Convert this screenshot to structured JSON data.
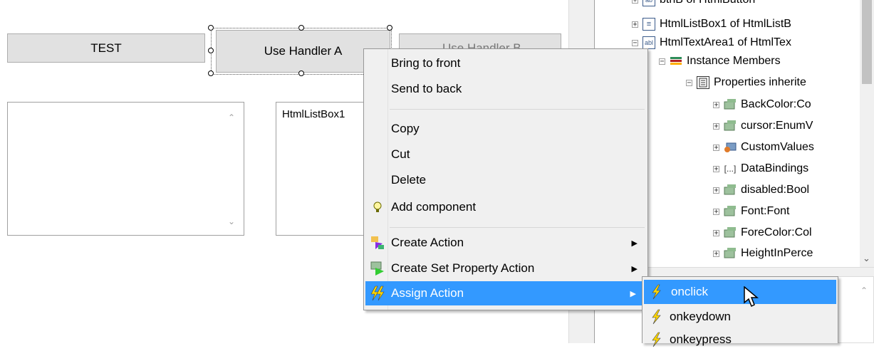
{
  "designer": {
    "test_button": "TEST",
    "handler_a_button": "Use Handler A",
    "handler_b_button": "Use Handler B",
    "listbox_label": "HtmlListBox1"
  },
  "context_menu": {
    "items": [
      {
        "label": "Bring to front"
      },
      {
        "label": "Send to back"
      },
      {
        "label": "Copy"
      },
      {
        "label": "Cut"
      },
      {
        "label": "Delete"
      },
      {
        "label": "Add component",
        "icon": "lightbulb-icon"
      },
      {
        "label": "Create Action",
        "icon": "create-action-icon",
        "submenu": true
      },
      {
        "label": "Create Set Property Action",
        "icon": "set-property-icon",
        "submenu": true
      },
      {
        "label": "Assign Action",
        "icon": "assign-action-icon",
        "submenu": true,
        "highlighted": true
      }
    ]
  },
  "submenu": {
    "items": [
      {
        "label": "onclick",
        "icon": "lightning-icon",
        "highlighted": true
      },
      {
        "label": "onkeydown",
        "icon": "lightning-icon"
      },
      {
        "label": "onkeypress",
        "icon": "lightning-icon"
      }
    ]
  },
  "tree": {
    "rows": [
      {
        "label": "btnB of HtmlButton",
        "icon": "ab-icon"
      },
      {
        "label": "HtmlListBox1 of HtmlListB",
        "icon": "listbox-icon"
      },
      {
        "label": "HtmlTextArea1 of HtmlTex",
        "icon": "textarea-icon"
      },
      {
        "label": "Instance Members",
        "icon": "members-icon"
      },
      {
        "label": "Properties inherite",
        "icon": "properties-icon"
      },
      {
        "label": "BackColor:Co",
        "icon": "property-icon"
      },
      {
        "label": "cursor:EnumV",
        "icon": "property-icon"
      },
      {
        "label": "CustomValues",
        "icon": "custom-values-icon"
      },
      {
        "label": "DataBindings",
        "icon": "bracket-icon"
      },
      {
        "label": "disabled:Bool",
        "icon": "property-icon"
      },
      {
        "label": "Font:Font",
        "icon": "property-icon"
      },
      {
        "label": "ForeColor:Col",
        "icon": "property-icon"
      },
      {
        "label": "HeightInPerce",
        "icon": "property-icon"
      }
    ]
  },
  "colors": {
    "highlight": "#3399ff",
    "menu_bg": "#f0f0f0",
    "button_bg": "#e1e1e1"
  }
}
